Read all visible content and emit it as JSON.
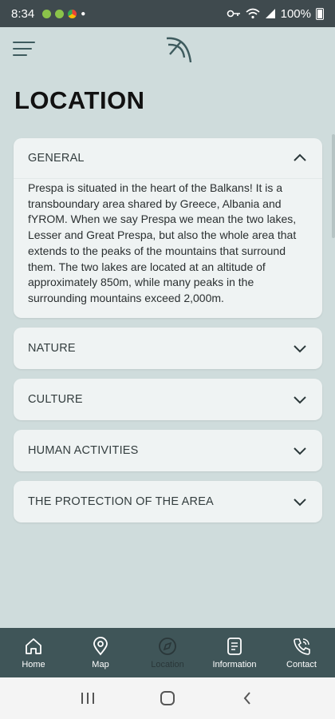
{
  "status_bar": {
    "time": "8:34",
    "battery": "100%",
    "app_colors": [
      "#8bc34a",
      "#8bc34a",
      "#ff5722"
    ]
  },
  "header": {
    "menu_icon": "hamburger-icon",
    "logo": "arch-logo"
  },
  "page": {
    "title": "LOCATION"
  },
  "accordion": [
    {
      "title": "GENERAL",
      "expanded": true,
      "body": "Prespa is situated in the heart of the Balkans! It is a transboundary area shared by Greece, Albania and fYROM. When we say Prespa we mean the two lakes, Lesser and Great Prespa, but also the whole area that extends to the peaks of the mountains that surround them. The two lakes are located at an altitude of approximately 850m, while many peaks in the surrounding mountains exceed 2,000m."
    },
    {
      "title": "NATURE",
      "expanded": false
    },
    {
      "title": "CULTURE",
      "expanded": false
    },
    {
      "title": "HUMAN ACTIVITIES",
      "expanded": false
    },
    {
      "title": "THE PROTECTION OF THE AREA",
      "expanded": false
    }
  ],
  "bottom_nav": [
    {
      "label": "Home",
      "icon": "home-icon",
      "active": false
    },
    {
      "label": "Map",
      "icon": "map-pin-icon",
      "active": false
    },
    {
      "label": "Location",
      "icon": "compass-icon",
      "active": true
    },
    {
      "label": "Information",
      "icon": "document-icon",
      "active": false
    },
    {
      "label": "Contact",
      "icon": "phone-icon",
      "active": false
    }
  ],
  "colors": {
    "background": "#cfdcdc",
    "card": "#eff3f3",
    "nav_bar": "#3f5558",
    "status_bar": "#3f4a4e"
  }
}
